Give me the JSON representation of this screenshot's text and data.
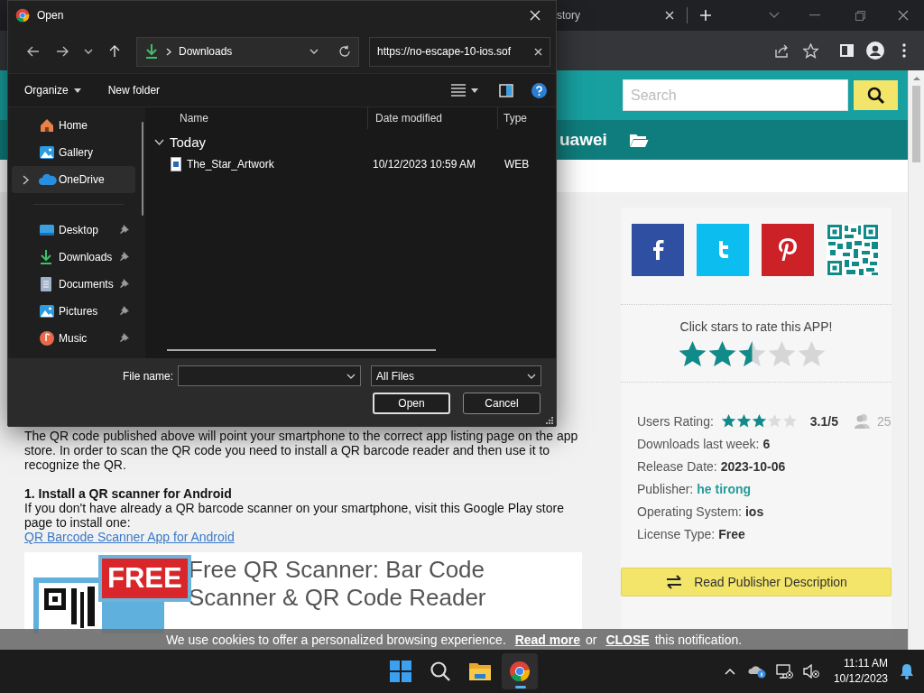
{
  "browser": {
    "tab_title": "story",
    "search": {
      "placeholder": "Search"
    },
    "header_text": "uawei"
  },
  "dialog": {
    "title": "Open",
    "breadcrumb": "Downloads",
    "address_value": "https://no-escape-10-ios.sof",
    "organize": "Organize",
    "new_folder": "New folder",
    "nav": [
      {
        "label": "Home",
        "selected": false,
        "pinned": false
      },
      {
        "label": "Gallery",
        "selected": false,
        "pinned": false
      },
      {
        "label": "OneDrive",
        "selected": true,
        "pinned": false
      },
      {
        "label": "Desktop",
        "selected": false,
        "pinned": true
      },
      {
        "label": "Downloads",
        "selected": false,
        "pinned": true
      },
      {
        "label": "Documents",
        "selected": false,
        "pinned": true
      },
      {
        "label": "Pictures",
        "selected": false,
        "pinned": true
      },
      {
        "label": "Music",
        "selected": false,
        "pinned": true
      }
    ],
    "columns": [
      "Name",
      "Date modified",
      "Type"
    ],
    "group": "Today",
    "files": [
      {
        "name": "The_Star_Artwork",
        "date": "10/12/2023 10:59 AM",
        "type": "WEB"
      }
    ],
    "file_name_label": "File name:",
    "file_type": "All Files",
    "open_button": "Open",
    "cancel_button": "Cancel"
  },
  "article": {
    "intro": "The QR code published above will point your smartphone to the correct app listing page on the app store. In order to scan the QR code you need to install a QR barcode reader and then use it to recognize the QR.",
    "heading": "1. Install a QR scanner for Android",
    "body": "If you don't have already a QR barcode scanner on your smartphone, visit this Google Play store page to install one:",
    "link": "QR Barcode Scanner App for Android",
    "promo": {
      "badge": "FREE",
      "title": "Free QR Scanner: Bar Code Scanner & QR Code Reader"
    }
  },
  "panel": {
    "rate_prompt": "Click stars to rate this APP!",
    "rating": {
      "stars": 2.5
    },
    "info": [
      {
        "kind": "rating",
        "label": "Users Rating:",
        "stars": 3,
        "value": "3.1/5",
        "count": "25"
      },
      {
        "kind": "text",
        "label": "Downloads last week:",
        "value": "6"
      },
      {
        "kind": "text",
        "label": "Release Date:",
        "value": "2023-10-06"
      },
      {
        "kind": "link",
        "label": "Publisher:",
        "value": "he tirong"
      },
      {
        "kind": "text",
        "label": "Operating System:",
        "value": "ios"
      },
      {
        "kind": "text",
        "label": "License Type:",
        "value": "Free"
      }
    ],
    "publisher_button": "Read Publisher Description"
  },
  "cookie": {
    "before": "We use cookies to offer a personalized browsing experience.",
    "read_more": "Read more",
    "or": "or",
    "close": "CLOSE",
    "after": "this notification."
  },
  "taskbar": {
    "apps": [
      {
        "kind": "start",
        "active": false
      },
      {
        "kind": "search",
        "active": false
      },
      {
        "kind": "explorer",
        "active": false
      },
      {
        "kind": "chrome",
        "active": true
      }
    ],
    "time": "11:11 AM",
    "date": "10/12/2023"
  }
}
